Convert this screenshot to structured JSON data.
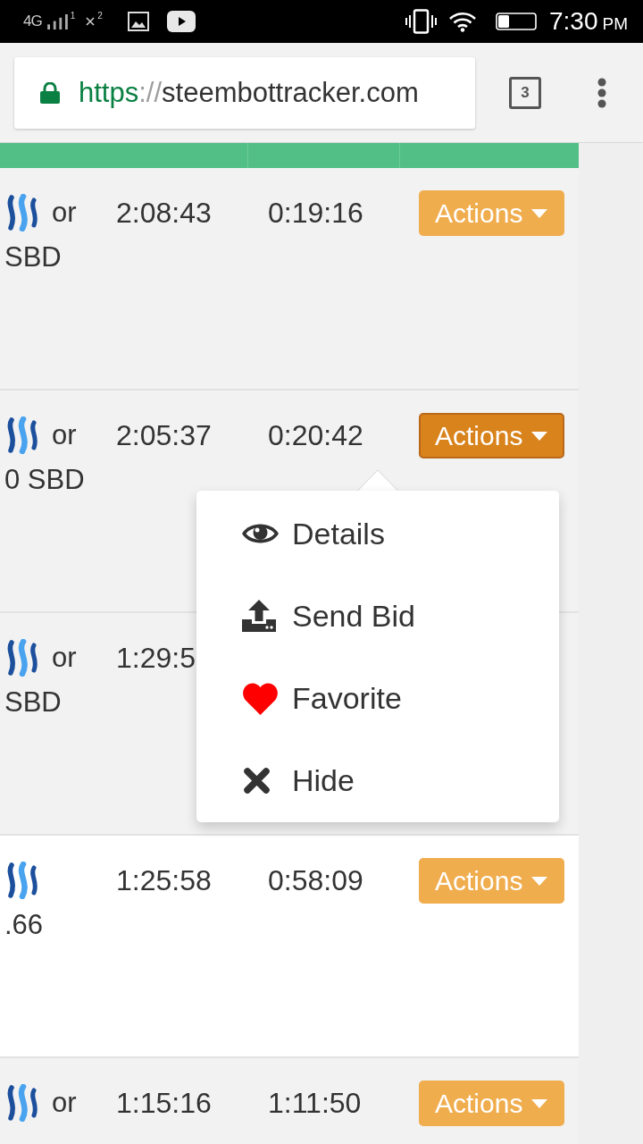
{
  "status_bar": {
    "network": "4G",
    "sim_1": "1",
    "sim_2": "2",
    "time": "7:30",
    "meridiem": "PM"
  },
  "browser_toolbar": {
    "url": {
      "scheme": "https",
      "separator": "://",
      "host": "steembottracker.com"
    },
    "tab_count": "3"
  },
  "table": {
    "rows": [
      {
        "shaded": true,
        "column_1": {
          "line_1": "or",
          "line_2": "SBD"
        },
        "column_2": "2:08:43",
        "column_3": "0:19:16",
        "column_4": {
          "label": "Actions",
          "active": false
        }
      },
      {
        "shaded": true,
        "column_1": {
          "line_1": "or",
          "line_2": "0 SBD"
        },
        "column_2": "2:05:37",
        "column_3": "0:20:42",
        "column_4": {
          "label": "Actions",
          "active": true
        }
      },
      {
        "shaded": true,
        "column_1": {
          "line_1": "or",
          "line_2": "SBD"
        },
        "column_2": "1:29:5"
      },
      {
        "shaded": false,
        "column_1": {
          "line_2": ".66"
        },
        "column_2": "1:25:58",
        "column_3": "0:58:09",
        "column_4": {
          "label": "Actions",
          "active": false
        }
      },
      {
        "shaded": true,
        "column_1": {
          "line_1": "or"
        },
        "column_2": "1:15:16",
        "column_3": "1:11:50",
        "column_4": {
          "label": "Actions",
          "active": false
        }
      }
    ]
  },
  "dropdown_menu": {
    "items": [
      {
        "kind": "view",
        "label": "Details"
      },
      {
        "kind": "upload",
        "label": "Send Bid"
      },
      {
        "kind": "favorite",
        "label": "Favorite"
      },
      {
        "kind": "remove",
        "label": "Hide"
      }
    ]
  }
}
